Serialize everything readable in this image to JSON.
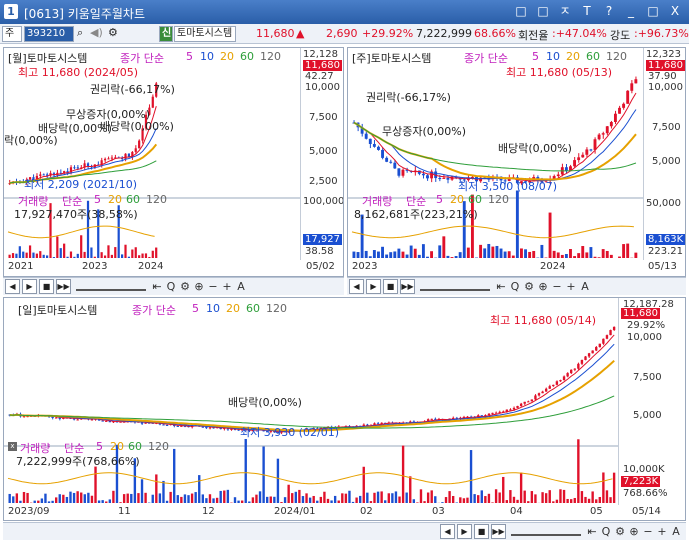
{
  "window": {
    "number": "1",
    "title": "[0613] 키움일주월차트",
    "buttons": [
      "□",
      "□",
      "ㅈ",
      "T",
      "?",
      "_",
      "□",
      "X"
    ]
  },
  "toolbar": {
    "market": "주",
    "code": "393210",
    "credit": "신",
    "name": "토마토시스템",
    "price": "11,680",
    "change_arrow": "▲",
    "change": "2,690",
    "change_pct": "+29.92%",
    "volume": "7,222,999",
    "turnover_pct": "68.66%",
    "turnover_label": "회전율",
    "turnover_value": ":+47.04%",
    "strength_label": "강도",
    "strength_value": ":+96.73%"
  },
  "monthly": {
    "title": "[월]토마토시스템",
    "ma": {
      "prefix": "종가 단순",
      "p1": "5",
      "p2": "10",
      "p3": "20",
      "p4": "60",
      "p5": "120"
    },
    "y_labels": [
      "12,128",
      "11,680",
      "42.27",
      "10,000",
      "7,500",
      "5,000",
      "2,500"
    ],
    "annotations": {
      "high": "최고 11,680 (2024/05)",
      "low": "최저 2,209 (2021/10)",
      "rights": "권리락(-66,17%)",
      "bonus": "무상증자(0,00%)",
      "dividend1": "배당락(0,00%)",
      "dividend2": "배당락(0,00%)",
      "left_partial": "락(0,00%)"
    },
    "vol_title": "거래량",
    "vol_ma": {
      "prefix": "단순",
      "p1": "5",
      "p2": "20",
      "p3": "60",
      "p4": "120"
    },
    "vol_value": "17,927,470주(38,58%)",
    "vol_y": [
      "100,000",
      "17,927",
      "38.58"
    ],
    "x_labels": [
      "2021",
      "2023",
      "2024",
      "05/02"
    ]
  },
  "weekly": {
    "title": "[주]토마토시스템",
    "ma": {
      "prefix": "종가 단순",
      "p1": "5",
      "p2": "10",
      "p3": "20",
      "p4": "60",
      "p5": "120"
    },
    "y_labels": [
      "12,323",
      "11,680",
      "37.90",
      "10,000",
      "7,500",
      "5,000"
    ],
    "annotations": {
      "high": "최고 11,680 (05/13)",
      "low": "최저 3,500 (08/07)",
      "rights": "권리락(-66,17%)",
      "bonus": "무상증자(0,00%)",
      "dividend": "배당락(0,00%)"
    },
    "vol_title": "거래량",
    "vol_ma": {
      "prefix": "단순",
      "p1": "5",
      "p2": "20",
      "p3": "60",
      "p4": "120"
    },
    "vol_value": "8,162,681주(223,21%)",
    "vol_y": [
      "50,000",
      "8,163K",
      "223.21"
    ],
    "x_labels": [
      "2023",
      "2024",
      "05/13"
    ]
  },
  "daily": {
    "title": "[일]토마토시스템",
    "ma": {
      "prefix": "종가 단순",
      "p1": "5",
      "p2": "10",
      "p3": "20",
      "p4": "60",
      "p5": "120"
    },
    "y_labels": [
      "12,187.28",
      "11,680",
      "29.92%",
      "10,000",
      "7,500",
      "5,000"
    ],
    "annotations": {
      "high": "최고 11,680 (05/14)",
      "low": "최저 3,930 (02/01)",
      "dividend": "배당락(0,00%)"
    },
    "vol_title": "거래량",
    "vol_ma": {
      "prefix": "단순",
      "p1": "5",
      "p2": "20",
      "p3": "60",
      "p4": "120"
    },
    "vol_value": "7,222,999주(768,66%)",
    "vol_y": [
      "10,000K",
      "7,223K",
      "768.66%"
    ],
    "x_labels": [
      "2023/09",
      "11",
      "12",
      "2024/01",
      "02",
      "03",
      "04",
      "05",
      "05/14"
    ]
  },
  "controls": {
    "buttons": [
      "◀",
      "▶",
      "■",
      "▶▶"
    ],
    "icons": [
      "⇤",
      "Q",
      "⚙",
      "⊕",
      "−",
      "+",
      "A"
    ]
  },
  "colors": {
    "up": "#e0112a",
    "down": "#1a4fd1",
    "ma5": "#e0112a",
    "ma10": "#1a4fd1",
    "ma20": "#e6a100",
    "ma60": "#2e9e3a",
    "ma120": "#666666",
    "accent": "#2a5ea8"
  }
}
